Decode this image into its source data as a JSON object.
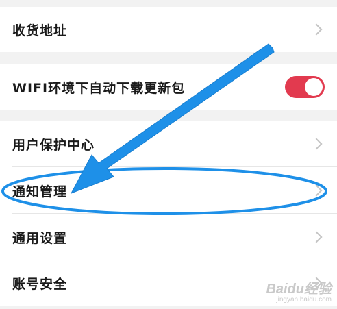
{
  "settings": {
    "items": [
      {
        "label": "收货地址"
      },
      {
        "label": "WIFI环境下自动下载更新包"
      },
      {
        "label": "用户保护中心"
      },
      {
        "label": "通知管理"
      },
      {
        "label": "通用设置"
      },
      {
        "label": "账号安全"
      }
    ],
    "wifi_auto_update_enabled": true
  },
  "colors": {
    "toggle_on": "#e23a4f",
    "annotation_blue": "#1e90e8"
  },
  "watermark": {
    "brand": "Baidu经验",
    "sub": "jingyan.baidu.com"
  }
}
